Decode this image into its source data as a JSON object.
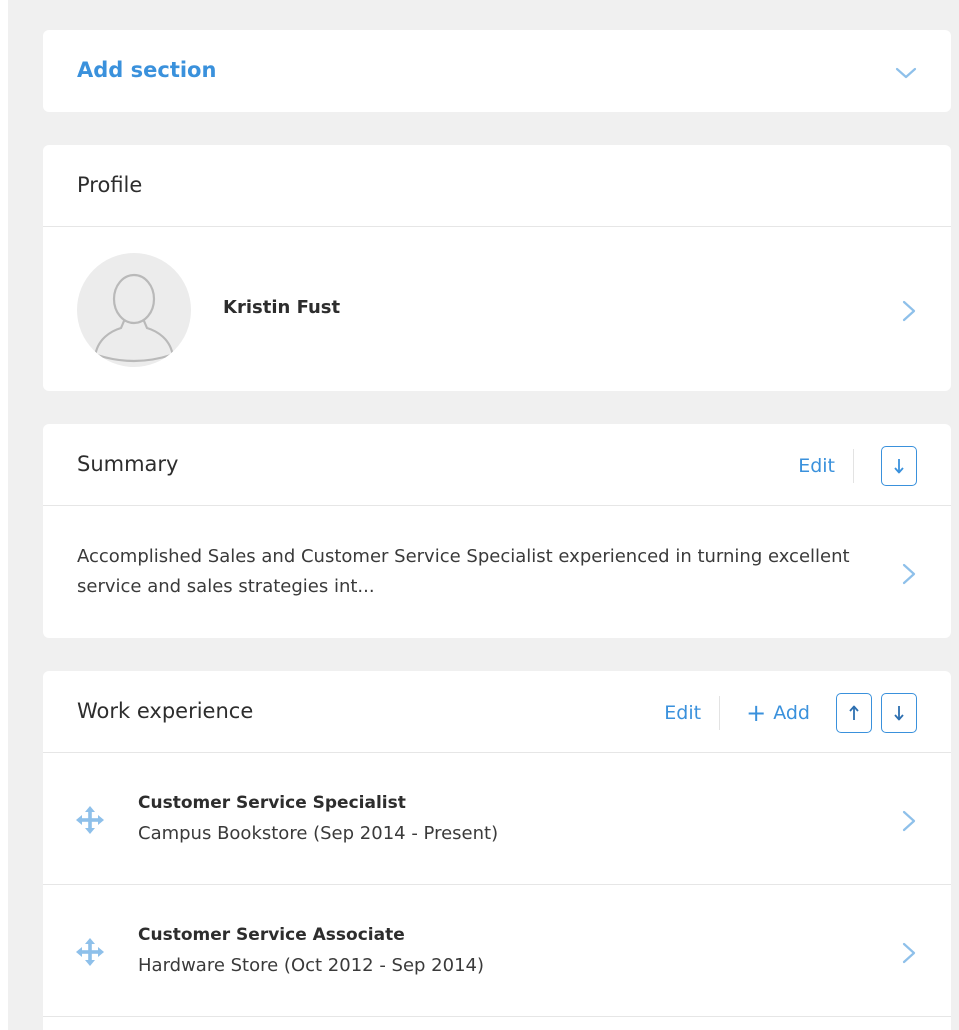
{
  "add_section": {
    "label": "Add section",
    "icon": "chevron-down-icon"
  },
  "profile": {
    "title": "Profile",
    "name": "Kristin Fust",
    "avatar_icon": "user-avatar-placeholder-icon"
  },
  "summary": {
    "title": "Summary",
    "edit_label": "Edit",
    "move_down_icon": "arrow-down-icon",
    "text": "Accomplished Sales and Customer Service Specialist experienced in turning excellent service and sales strategies int..."
  },
  "work_experience": {
    "title": "Work experience",
    "edit_label": "Edit",
    "add_label": "Add",
    "add_icon": "plus-icon",
    "move_up_icon": "arrow-up-icon",
    "move_down_icon": "arrow-down-icon",
    "items": [
      {
        "title": "Customer Service Specialist",
        "subtitle": "Campus Bookstore (Sep 2014 - Present)"
      },
      {
        "title": "Customer Service Associate",
        "subtitle": "Hardware Store (Oct 2012 - Sep 2014)"
      }
    ]
  },
  "colors": {
    "accent": "#3a91dc",
    "background": "#f0f0f0",
    "card": "#ffffff",
    "text": "#2d2d2d"
  }
}
